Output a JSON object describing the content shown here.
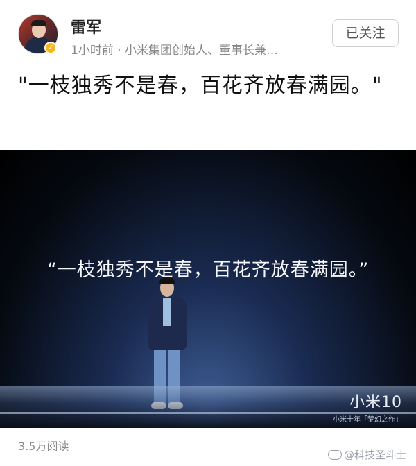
{
  "author": {
    "name": "雷军",
    "meta": "1小时前 · 小米集团创始人、董事长兼…",
    "verified_badge_icon": "verified-badge-icon",
    "avatar_icon": "avatar-icon"
  },
  "follow_button": {
    "label": "已关注"
  },
  "post": {
    "text": "\"一枝独秀不是春，百花齐放春满园。\""
  },
  "media": {
    "quote": "“一枝独秀不是春，百花齐放春满园。”",
    "brand_main": "小米10",
    "brand_sub": "小米十年「梦幻之作」"
  },
  "stats": {
    "reads": "3.5万阅读"
  },
  "watermark": {
    "text": "@科技圣斗士",
    "icon": "weibo-icon"
  },
  "colors": {
    "accent_badge": "#f5b821",
    "meta_gray": "#888888",
    "stage_blue": "#1a2b52"
  }
}
